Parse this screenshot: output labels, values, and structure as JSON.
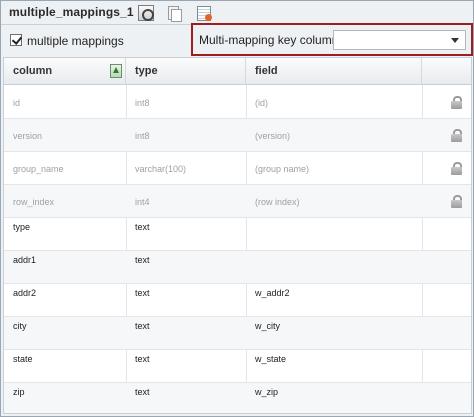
{
  "window": {
    "title": "multiple_mappings_1",
    "toolbar": [
      {
        "name": "edit-icon"
      },
      {
        "name": "copy-icon"
      },
      {
        "name": "properties-icon"
      }
    ]
  },
  "options": {
    "multiple_mappings_label": "multiple mappings",
    "multiple_mappings_checked": true,
    "key_column_label": "Multi-mapping key column:",
    "key_column_value": ""
  },
  "grid": {
    "columns": [
      {
        "label": "column"
      },
      {
        "label": "type"
      },
      {
        "label": "field"
      },
      {
        "label": ""
      }
    ],
    "rows": [
      {
        "column": "id",
        "type": "int8",
        "field": "(id)",
        "locked": true
      },
      {
        "column": "version",
        "type": "int8",
        "field": "(version)",
        "locked": true
      },
      {
        "column": "group_name",
        "type": "varchar(100)",
        "field": "(group name)",
        "locked": true
      },
      {
        "column": "row_index",
        "type": "int4",
        "field": "(row index)",
        "locked": true
      },
      {
        "column": "type",
        "type": "text",
        "field": "",
        "locked": false
      },
      {
        "column": "addr1",
        "type": "text",
        "field": "",
        "locked": false
      },
      {
        "column": "addr2",
        "type": "text",
        "field": "w_addr2",
        "locked": false
      },
      {
        "column": "city",
        "type": "text",
        "field": "w_city",
        "locked": false
      },
      {
        "column": "state",
        "type": "text",
        "field": "w_state",
        "locked": false
      },
      {
        "column": "zip",
        "type": "text",
        "field": "w_zip",
        "locked": false
      }
    ]
  },
  "colors": {
    "highlight_border": "#9d1e22",
    "system_text": "#a0a0a0"
  }
}
